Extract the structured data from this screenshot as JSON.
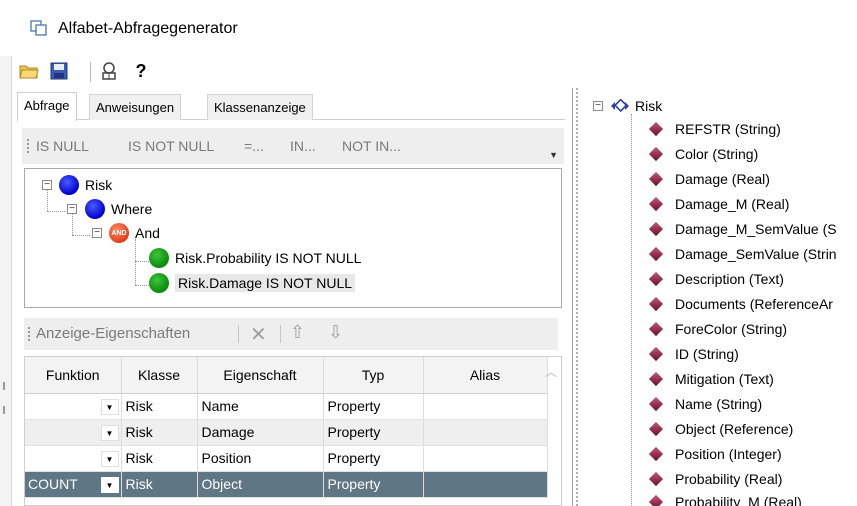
{
  "window": {
    "title": "Alfabet-Abfragegenerator"
  },
  "toolbar": {
    "open": "open-folder-icon",
    "save": "save-icon",
    "properties": "properties-icon",
    "help_label": "?"
  },
  "tabs": [
    {
      "label": "Abfrage",
      "active": true
    },
    {
      "label": "Anweisungen",
      "active": false
    },
    {
      "label": "Klassenanzeige",
      "active": false
    }
  ],
  "operators": [
    "IS NULL",
    "IS NOT NULL",
    "=...",
    "IN...",
    "NOT IN..."
  ],
  "query_tree": {
    "root": "Risk",
    "where": "Where",
    "and_badge": "AND",
    "and": "And",
    "conditions": [
      "Risk.Probability IS NOT NULL",
      "Risk.Damage IS NOT NULL"
    ]
  },
  "display_props": {
    "label": "Anzeige-Eigenschaften"
  },
  "grid": {
    "headers": [
      "Funktion",
      "Klasse",
      "Eigenschaft",
      "Typ",
      "Alias"
    ],
    "rows": [
      {
        "funktion": "",
        "klasse": "Risk",
        "eigenschaft": "Name",
        "typ": "Property",
        "alias": ""
      },
      {
        "funktion": "",
        "klasse": "Risk",
        "eigenschaft": "Damage",
        "typ": "Property",
        "alias": ""
      },
      {
        "funktion": "",
        "klasse": "Risk",
        "eigenschaft": "Position",
        "typ": "Property",
        "alias": ""
      },
      {
        "funktion": "COUNT",
        "klasse": "Risk",
        "eigenschaft": "Object",
        "typ": "Property",
        "alias": ""
      }
    ]
  },
  "class_tree": {
    "root": "Risk",
    "items": [
      "REFSTR (String)",
      "Color (String)",
      "Damage (Real)",
      "Damage_M (Real)",
      "Damage_M_SemValue (S",
      "Damage_SemValue (Strin",
      "Description (Text)",
      "Documents (ReferenceAr",
      "ForeColor (String)",
      "ID (String)",
      "Mitigation (Text)",
      "Name (String)",
      "Object (Reference)",
      "Position (Integer)",
      "Probability (Real)",
      "Probability_M (Real)"
    ]
  },
  "colors": {
    "selection": "#5f7785",
    "accent_blue": "#0000d0",
    "accent_green": "#0a8a0a"
  }
}
